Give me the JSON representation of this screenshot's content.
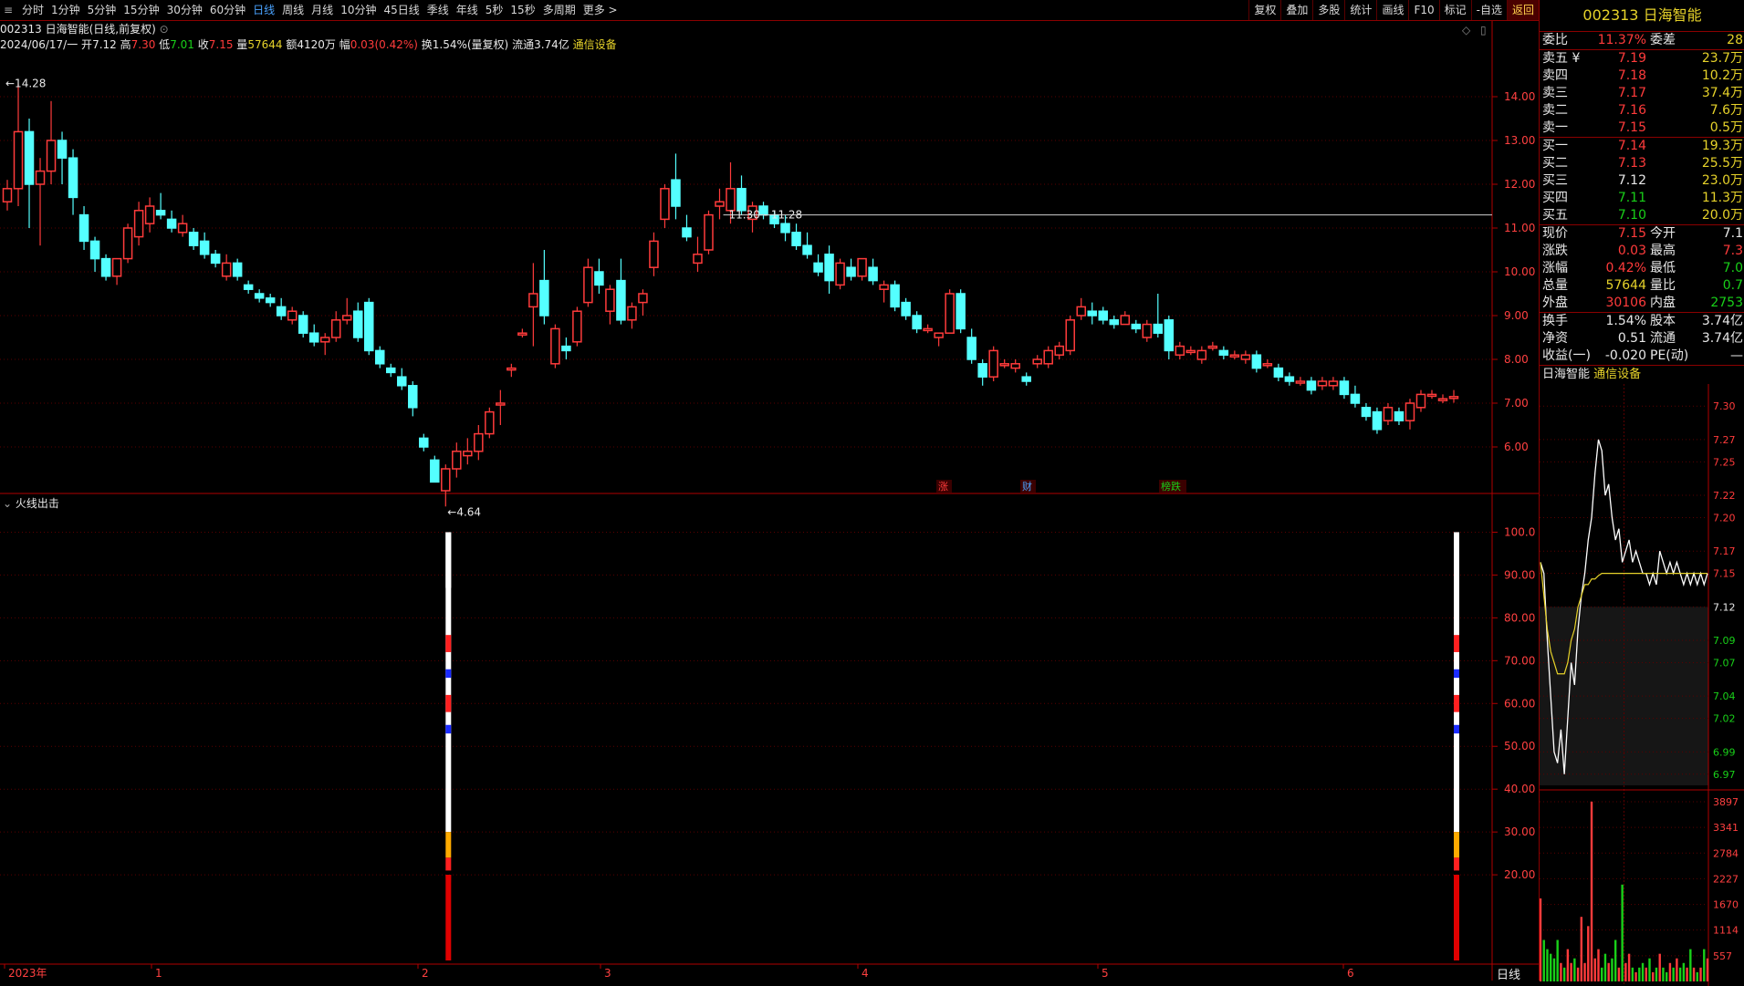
{
  "toolbar": {
    "periods": [
      "分时",
      "1分钟",
      "5分钟",
      "15分钟",
      "30分钟",
      "60分钟",
      "日线",
      "周线",
      "月线",
      "10分钟",
      "45日线",
      "季线",
      "年线",
      "5秒",
      "15秒",
      "多周期",
      "更多 >"
    ],
    "active_period": "日线",
    "tools": [
      "复权",
      "叠加",
      "多股",
      "统计",
      "画线",
      "F10",
      "标记",
      "-自选",
      "返回"
    ]
  },
  "info": {
    "code_name": "002313 日海智能(日线,前复权)",
    "date": "2024/06/17/一",
    "open_label": "开",
    "open": "7.12",
    "high_label": "高",
    "high": "7.30",
    "low_label": "低",
    "low": "7.01",
    "close_label": "收",
    "close": "7.15",
    "vol_label": "量",
    "vol": "57644",
    "amt": "额4120万",
    "chg_label": "幅",
    "chg": "0.03(0.42%)",
    "turn": "换1.54%(量复权)",
    "float": "流通3.74亿",
    "sector": "通信设备"
  },
  "indicator": {
    "name": "火线出击"
  },
  "period_label": "日线",
  "chart_data": [
    {
      "type": "candlestick",
      "title": "002313 日海智能(日线,前复权)",
      "ylim": [
        5.0,
        15.0
      ],
      "y_ticks": [
        "14.00",
        "13.00",
        "12.00",
        "11.00",
        "10.00",
        "9.00",
        "8.00",
        "7.00",
        "6.00"
      ],
      "x_ticks": [
        "2023年",
        "1",
        "2",
        "3",
        "4",
        "5",
        "6"
      ],
      "max_label": "14.28",
      "min_label": "4.64",
      "hline_label": "11.30 - 11.28",
      "hline_value": 11.3,
      "event_tags": [
        "涨",
        "财",
        "榜跌"
      ],
      "candles_ohlc": [
        [
          11.6,
          12.1,
          11.4,
          11.9
        ],
        [
          11.9,
          14.3,
          11.5,
          13.2
        ],
        [
          13.2,
          13.5,
          11.0,
          12.0
        ],
        [
          12.0,
          12.6,
          10.6,
          12.3
        ],
        [
          12.3,
          13.9,
          12.0,
          13.0
        ],
        [
          13.0,
          13.2,
          12.0,
          12.6
        ],
        [
          12.6,
          12.8,
          11.3,
          11.7
        ],
        [
          11.3,
          11.5,
          10.5,
          10.7
        ],
        [
          10.7,
          10.8,
          10.0,
          10.3
        ],
        [
          10.3,
          10.4,
          9.8,
          9.9
        ],
        [
          9.9,
          10.0,
          9.7,
          10.3
        ],
        [
          10.3,
          11.1,
          10.2,
          11.0
        ],
        [
          10.8,
          11.6,
          10.6,
          11.4
        ],
        [
          11.1,
          11.7,
          10.9,
          11.5
        ],
        [
          11.4,
          11.8,
          11.2,
          11.3
        ],
        [
          11.2,
          11.4,
          10.9,
          11.0
        ],
        [
          10.9,
          11.3,
          10.8,
          11.1
        ],
        [
          10.9,
          11.0,
          10.5,
          10.6
        ],
        [
          10.7,
          10.9,
          10.3,
          10.4
        ],
        [
          10.4,
          10.5,
          10.1,
          10.2
        ],
        [
          9.9,
          10.4,
          9.8,
          10.2
        ],
        [
          10.2,
          10.3,
          9.8,
          9.9
        ],
        [
          9.7,
          9.8,
          9.5,
          9.6
        ],
        [
          9.5,
          9.6,
          9.3,
          9.4
        ],
        [
          9.4,
          9.5,
          9.2,
          9.3
        ],
        [
          9.2,
          9.4,
          8.9,
          9.0
        ],
        [
          8.9,
          9.2,
          8.8,
          9.1
        ],
        [
          9.0,
          9.1,
          8.5,
          8.6
        ],
        [
          8.6,
          8.8,
          8.3,
          8.4
        ],
        [
          8.4,
          8.6,
          8.1,
          8.5
        ],
        [
          8.5,
          9.1,
          8.4,
          8.9
        ],
        [
          8.9,
          9.4,
          8.8,
          9.0
        ],
        [
          9.1,
          9.3,
          8.4,
          8.5
        ],
        [
          9.3,
          9.4,
          8.1,
          8.2
        ],
        [
          8.2,
          8.3,
          7.8,
          7.9
        ],
        [
          7.8,
          7.9,
          7.6,
          7.7
        ],
        [
          7.6,
          7.8,
          7.3,
          7.4
        ],
        [
          7.4,
          7.5,
          6.7,
          6.9
        ],
        [
          6.2,
          6.3,
          5.9,
          6.0
        ],
        [
          5.7,
          5.8,
          5.2,
          5.2
        ],
        [
          5.0,
          5.6,
          4.64,
          5.5
        ],
        [
          5.5,
          6.1,
          5.3,
          5.9
        ],
        [
          5.8,
          6.2,
          5.6,
          5.9
        ],
        [
          5.9,
          6.5,
          5.7,
          6.3
        ],
        [
          6.3,
          6.9,
          6.2,
          6.8
        ],
        [
          7.0,
          7.3,
          6.5,
          7.0
        ],
        [
          7.8,
          7.9,
          7.6,
          7.8
        ],
        [
          8.6,
          8.7,
          8.5,
          8.6
        ],
        [
          9.2,
          10.2,
          8.3,
          9.5
        ],
        [
          9.8,
          10.5,
          8.8,
          9.0
        ],
        [
          7.9,
          8.8,
          7.8,
          8.7
        ],
        [
          8.3,
          8.5,
          8.0,
          8.2
        ],
        [
          8.4,
          9.2,
          8.3,
          9.1
        ],
        [
          9.3,
          10.3,
          9.2,
          10.1
        ],
        [
          10.0,
          10.3,
          9.5,
          9.7
        ],
        [
          9.1,
          9.7,
          8.8,
          9.6
        ],
        [
          9.8,
          10.3,
          8.8,
          8.9
        ],
        [
          8.9,
          9.3,
          8.7,
          9.2
        ],
        [
          9.3,
          9.6,
          9.0,
          9.5
        ],
        [
          10.1,
          10.9,
          9.9,
          10.7
        ],
        [
          11.2,
          12.0,
          11.0,
          11.9
        ],
        [
          12.1,
          12.7,
          11.2,
          11.5
        ],
        [
          11.0,
          11.3,
          10.7,
          10.8
        ],
        [
          10.2,
          10.8,
          10.0,
          10.4
        ],
        [
          10.5,
          11.4,
          10.4,
          11.3
        ],
        [
          11.5,
          11.9,
          11.2,
          11.6
        ],
        [
          11.4,
          12.5,
          11.1,
          11.9
        ],
        [
          11.9,
          12.2,
          11.3,
          11.4
        ],
        [
          11.2,
          11.6,
          10.9,
          11.5
        ],
        [
          11.5,
          11.6,
          11.2,
          11.3
        ],
        [
          11.3,
          11.4,
          11.0,
          11.1
        ],
        [
          11.1,
          11.3,
          10.7,
          10.9
        ],
        [
          10.9,
          11.1,
          10.5,
          10.6
        ],
        [
          10.6,
          10.9,
          10.3,
          10.4
        ],
        [
          10.2,
          10.4,
          9.9,
          10.0
        ],
        [
          10.4,
          10.6,
          9.5,
          9.8
        ],
        [
          9.7,
          10.3,
          9.6,
          10.2
        ],
        [
          10.1,
          10.3,
          9.8,
          9.9
        ],
        [
          9.9,
          10.3,
          9.8,
          10.3
        ],
        [
          10.1,
          10.3,
          9.7,
          9.8
        ],
        [
          9.6,
          9.8,
          9.3,
          9.7
        ],
        [
          9.7,
          9.8,
          9.1,
          9.2
        ],
        [
          9.3,
          9.4,
          8.9,
          9.0
        ],
        [
          9.0,
          9.1,
          8.6,
          8.7
        ],
        [
          8.7,
          8.8,
          8.6,
          8.7
        ],
        [
          8.5,
          8.6,
          8.3,
          8.6
        ],
        [
          8.6,
          9.6,
          8.6,
          9.5
        ],
        [
          9.5,
          9.6,
          8.6,
          8.7
        ],
        [
          8.5,
          8.7,
          7.9,
          8.0
        ],
        [
          7.9,
          8.0,
          7.4,
          7.6
        ],
        [
          7.6,
          8.3,
          7.5,
          8.2
        ],
        [
          7.9,
          8.0,
          7.8,
          7.9
        ],
        [
          7.8,
          8.0,
          7.7,
          7.9
        ],
        [
          7.6,
          7.7,
          7.4,
          7.5
        ],
        [
          7.9,
          8.1,
          7.8,
          8.0
        ],
        [
          7.9,
          8.3,
          7.8,
          8.2
        ],
        [
          8.1,
          8.4,
          8.0,
          8.3
        ],
        [
          8.2,
          9.0,
          8.1,
          8.9
        ],
        [
          9.0,
          9.4,
          8.9,
          9.2
        ],
        [
          9.1,
          9.3,
          8.8,
          9.0
        ],
        [
          9.1,
          9.2,
          8.8,
          8.9
        ],
        [
          8.9,
          9.0,
          8.7,
          8.8
        ],
        [
          8.8,
          9.1,
          8.8,
          9.0
        ],
        [
          8.8,
          8.9,
          8.6,
          8.7
        ],
        [
          8.5,
          8.9,
          8.4,
          8.8
        ],
        [
          8.8,
          9.5,
          8.5,
          8.6
        ],
        [
          8.9,
          9.0,
          8.0,
          8.2
        ],
        [
          8.1,
          8.4,
          8.0,
          8.3
        ],
        [
          8.2,
          8.3,
          8.1,
          8.2
        ],
        [
          8.0,
          8.3,
          7.9,
          8.2
        ],
        [
          8.3,
          8.4,
          8.2,
          8.3
        ],
        [
          8.2,
          8.3,
          8.0,
          8.1
        ],
        [
          8.1,
          8.2,
          8.0,
          8.1
        ],
        [
          8.0,
          8.2,
          7.9,
          8.1
        ],
        [
          8.1,
          8.2,
          7.7,
          7.8
        ],
        [
          7.9,
          8.0,
          7.8,
          7.9
        ],
        [
          7.8,
          7.9,
          7.5,
          7.6
        ],
        [
          7.6,
          7.7,
          7.4,
          7.5
        ],
        [
          7.5,
          7.6,
          7.4,
          7.5
        ],
        [
          7.5,
          7.6,
          7.2,
          7.3
        ],
        [
          7.4,
          7.6,
          7.3,
          7.5
        ],
        [
          7.4,
          7.6,
          7.3,
          7.5
        ],
        [
          7.5,
          7.6,
          7.1,
          7.2
        ],
        [
          7.2,
          7.4,
          6.9,
          7.0
        ],
        [
          6.9,
          7.0,
          6.6,
          6.7
        ],
        [
          6.8,
          6.9,
          6.3,
          6.4
        ],
        [
          6.6,
          7.0,
          6.5,
          6.9
        ],
        [
          6.8,
          6.9,
          6.5,
          6.6
        ],
        [
          6.6,
          7.1,
          6.4,
          7.0
        ],
        [
          6.9,
          7.3,
          6.8,
          7.2
        ],
        [
          7.2,
          7.3,
          7.1,
          7.2
        ],
        [
          7.1,
          7.2,
          7.0,
          7.1
        ],
        [
          7.12,
          7.3,
          7.01,
          7.15
        ]
      ]
    },
    {
      "type": "bar",
      "title": "火线出击",
      "ylim": [
        0,
        105
      ],
      "y_ticks": [
        "100.0",
        "90.00",
        "80.00",
        "70.00",
        "60.00",
        "50.00",
        "40.00",
        "30.00",
        "20.00"
      ],
      "signal_value": 100,
      "signal_candle_indices": [
        40,
        132
      ]
    },
    {
      "type": "line",
      "title": "日海智能 通信设备",
      "price_ticks": [
        "7.30",
        "7.27",
        "7.25",
        "7.22",
        "7.20",
        "7.17",
        "7.15",
        "7.12",
        "7.09",
        "7.07",
        "7.04",
        "7.02",
        "6.99",
        "6.97"
      ],
      "vol_ticks": [
        "3897",
        "3341",
        "2784",
        "2227",
        "1670",
        "1114",
        "557"
      ],
      "ylim": [
        6.96,
        7.31
      ],
      "prev_close": 7.12,
      "price": [
        7.16,
        7.15,
        7.09,
        7.04,
        6.99,
        6.98,
        7.01,
        6.97,
        7.02,
        7.07,
        7.05,
        7.1,
        7.13,
        7.15,
        7.18,
        7.2,
        7.24,
        7.27,
        7.26,
        7.22,
        7.23,
        7.2,
        7.18,
        7.19,
        7.16,
        7.17,
        7.18,
        7.16,
        7.17,
        7.16,
        7.15,
        7.15,
        7.14,
        7.15,
        7.14,
        7.17,
        7.16,
        7.15,
        7.16,
        7.15,
        7.16,
        7.15,
        7.14,
        7.15,
        7.14,
        7.15,
        7.14,
        7.15,
        7.14,
        7.15
      ],
      "avg": [
        7.16,
        7.13,
        7.1,
        7.08,
        7.07,
        7.06,
        7.06,
        7.06,
        7.07,
        7.09,
        7.1,
        7.12,
        7.13,
        7.14,
        7.14,
        7.145,
        7.145,
        7.148,
        7.15,
        7.15,
        7.15,
        7.15,
        7.15,
        7.15,
        7.15,
        7.15,
        7.15,
        7.15,
        7.15,
        7.15,
        7.15,
        7.15,
        7.15,
        7.15,
        7.15,
        7.15,
        7.15,
        7.15,
        7.15,
        7.15,
        7.15,
        7.15,
        7.15,
        7.15,
        7.15,
        7.15,
        7.15,
        7.15,
        7.15,
        7.15
      ],
      "volume": [
        1800,
        900,
        700,
        600,
        500,
        900,
        400,
        300,
        700,
        400,
        500,
        300,
        1400,
        400,
        1200,
        3900,
        500,
        700,
        300,
        600,
        400,
        500,
        900,
        300,
        2100,
        400,
        600,
        300,
        200,
        300,
        400,
        300,
        500,
        200,
        300,
        600,
        300,
        200,
        400,
        300,
        500,
        300,
        400,
        300,
        700,
        300,
        200,
        300,
        700,
        500
      ]
    }
  ],
  "side": {
    "code": "002313",
    "name": "日海智能",
    "ratio": {
      "l1": "委比",
      "v1": "11.37%",
      "l2": "委差",
      "v2": "28"
    },
    "asks": [
      {
        "label": "卖五 ¥",
        "price": "7.19",
        "vol": "23.7万"
      },
      {
        "label": "卖四",
        "price": "7.18",
        "vol": "10.2万"
      },
      {
        "label": "卖三",
        "price": "7.17",
        "vol": "37.4万"
      },
      {
        "label": "卖二",
        "price": "7.16",
        "vol": "7.6万"
      },
      {
        "label": "卖一",
        "price": "7.15",
        "vol": "0.5万"
      }
    ],
    "bids": [
      {
        "label": "买一",
        "price": "7.14",
        "vol": "19.3万"
      },
      {
        "label": "买二",
        "price": "7.13",
        "vol": "25.5万"
      },
      {
        "label": "买三",
        "price": "7.12",
        "vol": "23.0万"
      },
      {
        "label": "买四",
        "price": "7.11",
        "vol": "11.3万"
      },
      {
        "label": "买五",
        "price": "7.10",
        "vol": "20.0万"
      }
    ],
    "stats": [
      {
        "l1": "现价",
        "v1": "7.15",
        "c1": "#ff3b3b",
        "l2": "今开",
        "v2": "7.1",
        "c2": "#e8e8e8"
      },
      {
        "l1": "涨跌",
        "v1": "0.03",
        "c1": "#ff3b3b",
        "l2": "最高",
        "v2": "7.3",
        "c2": "#ff3b3b"
      },
      {
        "l1": "涨幅",
        "v1": "0.42%",
        "c1": "#ff3b3b",
        "l2": "最低",
        "v2": "7.0",
        "c2": "#19d019"
      },
      {
        "l1": "总量",
        "v1": "57644",
        "c1": "#e6d22a",
        "l2": "量比",
        "v2": "0.7",
        "c2": "#19d019"
      },
      {
        "l1": "外盘",
        "v1": "30106",
        "c1": "#ff3b3b",
        "l2": "内盘",
        "v2": "2753",
        "c2": "#19d019"
      }
    ],
    "stats2": [
      {
        "l1": "换手",
        "v1": "1.54%",
        "c1": "#e8e8e8",
        "l2": "股本",
        "v2": "3.74亿",
        "c2": "#e8e8e8"
      },
      {
        "l1": "净资",
        "v1": "0.51",
        "c1": "#e8e8e8",
        "l2": "流通",
        "v2": "3.74亿",
        "c2": "#e8e8e8"
      },
      {
        "l1": "收益(一)",
        "v1": "-0.020",
        "c1": "#e8e8e8",
        "l2": "PE(动)",
        "v2": "—",
        "c2": "#e8e8e8"
      }
    ],
    "mini_title": "日海智能",
    "mini_sector": "通信设备"
  },
  "colors": {
    "up": "#ff3b3b",
    "down": "#54ffff",
    "grid": "#5a0000",
    "axis": "#b00000",
    "avg": "#e6d22a"
  }
}
